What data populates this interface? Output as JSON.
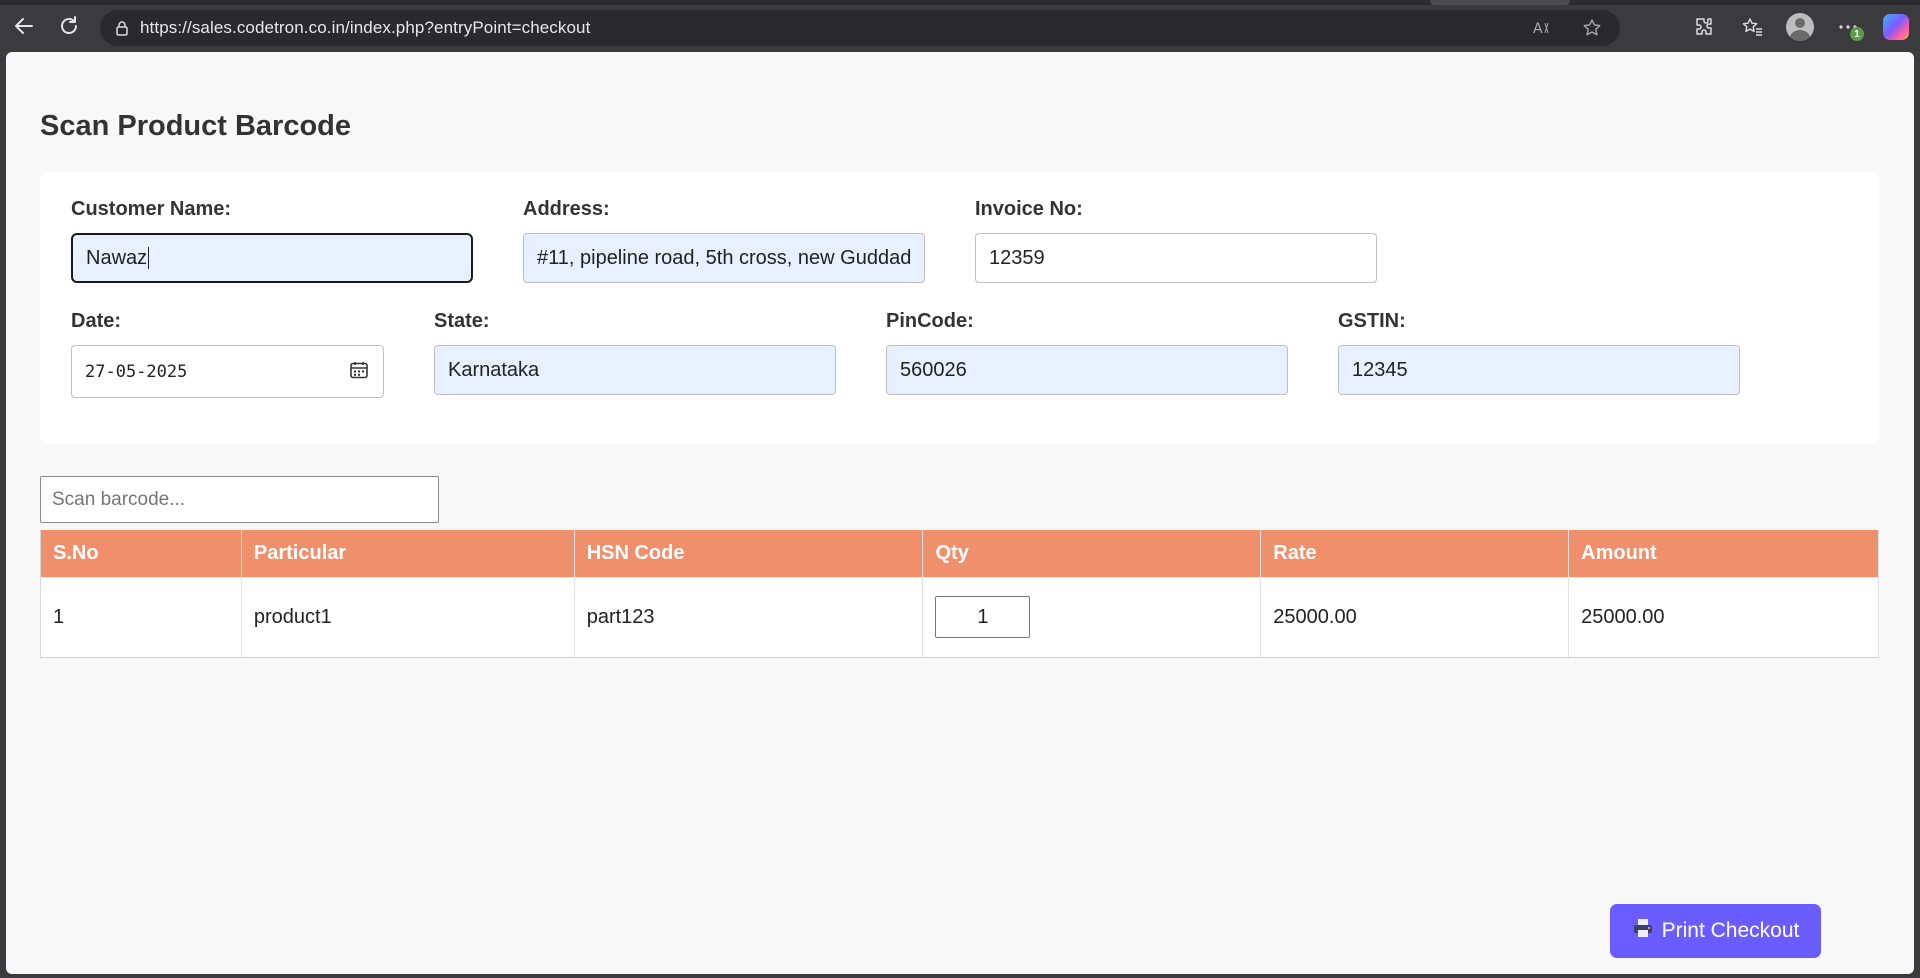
{
  "browser": {
    "url": "https://sales.codetron.co.in/index.php?entryPoint=checkout",
    "update_badge": "1"
  },
  "page": {
    "title": "Scan Product Barcode"
  },
  "form": {
    "customer_name": {
      "label": "Customer Name:",
      "value": "Nawaz"
    },
    "address": {
      "label": "Address:",
      "value": "#11, pipeline road, 5th cross, new Guddad"
    },
    "invoice_no": {
      "label": "Invoice No:",
      "value": "12359"
    },
    "date": {
      "label": "Date:",
      "value": "27-05-2025"
    },
    "state": {
      "label": "State:",
      "value": "Karnataka"
    },
    "pincode": {
      "label": "PinCode:",
      "value": "560026"
    },
    "gstin": {
      "label": "GSTIN:",
      "value": "12345"
    }
  },
  "barcode": {
    "placeholder": "Scan barcode..."
  },
  "table": {
    "headers": [
      "S.No",
      "Particular",
      "HSN Code",
      "Qty",
      "Rate",
      "Amount"
    ],
    "rows": [
      {
        "sno": "1",
        "particular": "product1",
        "hsn": "part123",
        "qty": "1",
        "rate": "25000.00",
        "amount": "25000.00"
      }
    ]
  },
  "actions": {
    "print_label": "Print Checkout"
  },
  "colors": {
    "table_header": "#f08f6b",
    "print_button": "#6b5cff",
    "autofill_bg": "#e8f0fe"
  }
}
